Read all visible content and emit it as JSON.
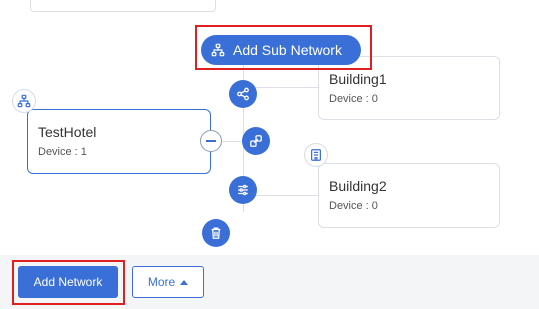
{
  "topology": {
    "root_node": {
      "name": "TestHotel",
      "device_count": "Device : 1",
      "icon": "network-topology-icon"
    },
    "children": [
      {
        "name": "Building1",
        "device_count": "Device : 0",
        "icon": "building-icon"
      },
      {
        "name": "Building2",
        "device_count": "Device : 0",
        "icon": "building-icon"
      }
    ],
    "actions": {
      "add_sub_network": "Add Sub Network",
      "share_icon": "share-icon",
      "link_icon": "link-icon",
      "settings_icon": "settings-sliders-icon",
      "delete_icon": "trash-icon",
      "collapse_icon": "minus-icon"
    }
  },
  "footer": {
    "add_network": "Add Network",
    "more": "More"
  },
  "colors": {
    "primary": "#3a6fd8",
    "highlight": "#e02020",
    "border": "#dcdfe6",
    "footer_bg": "#f4f5f7"
  }
}
